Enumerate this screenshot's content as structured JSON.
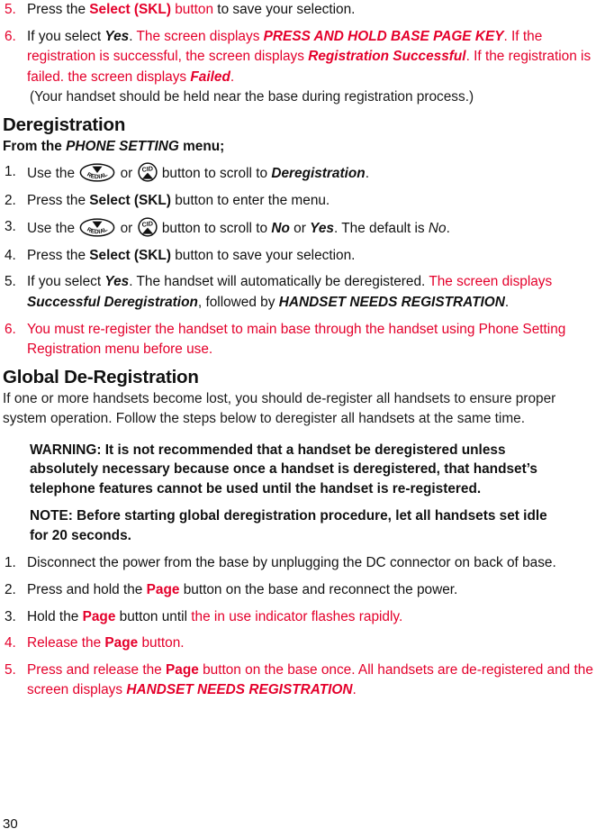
{
  "page": {
    "folio": "30"
  },
  "colors": {
    "accent_red": "#e4002b",
    "body_black": "#111111"
  },
  "icons": {
    "redial": {
      "name": "redial-button-icon",
      "label": "REDIAL",
      "arrow": "down"
    },
    "cid": {
      "name": "cid-button-icon",
      "label": "CID",
      "arrow": "up"
    }
  },
  "top_list": {
    "items": [
      {
        "number": "5.",
        "number_color": "red",
        "segments": [
          {
            "t": "Press the ",
            "c": "black"
          },
          {
            "t": "Select (SKL)",
            "c": "red",
            "s": "bold"
          },
          {
            "t": " button",
            "c": "red"
          },
          {
            "t": " to save your selection.",
            "c": "black"
          }
        ]
      },
      {
        "number": "6.",
        "number_color": "red",
        "segments": [
          {
            "t": "If you select ",
            "c": "black"
          },
          {
            "t": "Yes",
            "c": "black",
            "s": "bold-italic"
          },
          {
            "t": ". ",
            "c": "black"
          },
          {
            "t": "The screen displays ",
            "c": "red"
          },
          {
            "t": "PRESS AND HOLD BASE PAGE KEY",
            "c": "red",
            "s": "bold-italic"
          },
          {
            "t": ". If the registration is successful, the screen displays ",
            "c": "red"
          },
          {
            "t": "Registration Successful",
            "c": "red",
            "s": "bold-italic"
          },
          {
            "t": ". If the registration is failed. the screen displays ",
            "c": "red"
          },
          {
            "t": "Failed",
            "c": "red",
            "s": "bold-italic"
          },
          {
            "t": ".",
            "c": "red"
          }
        ],
        "continuation": "(Your handset should be held near the base during registration process.)"
      }
    ]
  },
  "deregistration": {
    "heading": "Deregistration",
    "subheading_prefix": "From the ",
    "subheading_emphasis": "PHONE SETTING",
    "subheading_suffix": " menu;",
    "items": [
      {
        "number": "1.",
        "number_color": "black",
        "pre": "Use the ",
        "mid": " or ",
        "post_segments": [
          {
            "t": " button to scroll to ",
            "c": "black"
          },
          {
            "t": "Deregistration",
            "c": "black",
            "s": "bold-italic"
          },
          {
            "t": ".",
            "c": "black"
          }
        ]
      },
      {
        "number": "2.",
        "number_color": "black",
        "segments": [
          {
            "t": "Press the ",
            "c": "black"
          },
          {
            "t": "Select (SKL)",
            "c": "black",
            "s": "bold"
          },
          {
            "t": " button to enter the menu.",
            "c": "black"
          }
        ]
      },
      {
        "number": "3.",
        "number_color": "black",
        "pre": "Use the ",
        "mid": " or ",
        "post_segments": [
          {
            "t": " button to scroll to ",
            "c": "black"
          },
          {
            "t": "No",
            "c": "black",
            "s": "bold-italic"
          },
          {
            "t": " or ",
            "c": "black"
          },
          {
            "t": "Yes",
            "c": "black",
            "s": "bold-italic"
          },
          {
            "t": ". The default is ",
            "c": "black"
          },
          {
            "t": "No",
            "c": "black",
            "s": "italic"
          },
          {
            "t": ".",
            "c": "black"
          }
        ]
      },
      {
        "number": "4.",
        "number_color": "black",
        "segments": [
          {
            "t": "Press the ",
            "c": "black"
          },
          {
            "t": "Select (SKL)",
            "c": "black",
            "s": "bold"
          },
          {
            "t": " button to save your selection.",
            "c": "black"
          }
        ]
      },
      {
        "number": "5.",
        "number_color": "black",
        "segments": [
          {
            "t": "If you select ",
            "c": "black"
          },
          {
            "t": "Yes",
            "c": "black",
            "s": "bold-italic"
          },
          {
            "t": ". The handset will automatically be deregistered. ",
            "c": "black"
          },
          {
            "t": "The screen displays ",
            "c": "red"
          },
          {
            "t": "Successful Deregistration",
            "c": "black",
            "s": "bold-italic"
          },
          {
            "t": ", followed by ",
            "c": "black"
          },
          {
            "t": "HANDSET NEEDS REGISTRATION",
            "c": "black",
            "s": "bold-italic"
          },
          {
            "t": ".",
            "c": "black"
          }
        ]
      },
      {
        "number": "6.",
        "number_color": "red",
        "segments": [
          {
            "t": "You must re-register the handset to main base through the handset using Phone Setting Registration menu before use.",
            "c": "red"
          }
        ]
      }
    ]
  },
  "global_deregistration": {
    "heading": "Global De-Registration",
    "intro": "If one or more handsets become lost, you should de-register all handsets to ensure proper system operation. Follow the steps below to deregister all handsets at the same time.",
    "warning": "WARNING: It is not recommended that a handset be deregistered unless absolutely necessary because once a handset is deregistered, that handset’s telephone features cannot be used until the handset is re-registered.",
    "note": "NOTE: Before starting global deregistration procedure, let all handsets set idle for 20 seconds.",
    "items": [
      {
        "number": "1.",
        "number_color": "black",
        "segments": [
          {
            "t": "Disconnect the power from the base by unplugging the DC connector on back of base.",
            "c": "black"
          }
        ]
      },
      {
        "number": "2.",
        "number_color": "black",
        "segments": [
          {
            "t": "Press and hold the ",
            "c": "black"
          },
          {
            "t": "Page",
            "c": "red",
            "s": "bold"
          },
          {
            "t": " button on the base and reconnect the power.",
            "c": "black"
          }
        ]
      },
      {
        "number": "3.",
        "number_color": "black",
        "segments": [
          {
            "t": "Hold the ",
            "c": "black"
          },
          {
            "t": "Page",
            "c": "red",
            "s": "bold"
          },
          {
            "t": " button until ",
            "c": "black"
          },
          {
            "t": "the in use indicator flashes rapidly.",
            "c": "red"
          }
        ]
      },
      {
        "number": "4.",
        "number_color": "red",
        "segments": [
          {
            "t": "Release the ",
            "c": "red"
          },
          {
            "t": "Page",
            "c": "red",
            "s": "bold"
          },
          {
            "t": " button.",
            "c": "red"
          }
        ]
      },
      {
        "number": "5.",
        "number_color": "red",
        "segments": [
          {
            "t": "Press and release the ",
            "c": "red"
          },
          {
            "t": "Page",
            "c": "red",
            "s": "bold"
          },
          {
            "t": " button on the base once. All handsets are de-registered and the screen displays ",
            "c": "red"
          },
          {
            "t": "HANDSET NEEDS REGISTRATION",
            "c": "red",
            "s": "bold-italic"
          },
          {
            "t": ".",
            "c": "red"
          }
        ]
      }
    ]
  }
}
